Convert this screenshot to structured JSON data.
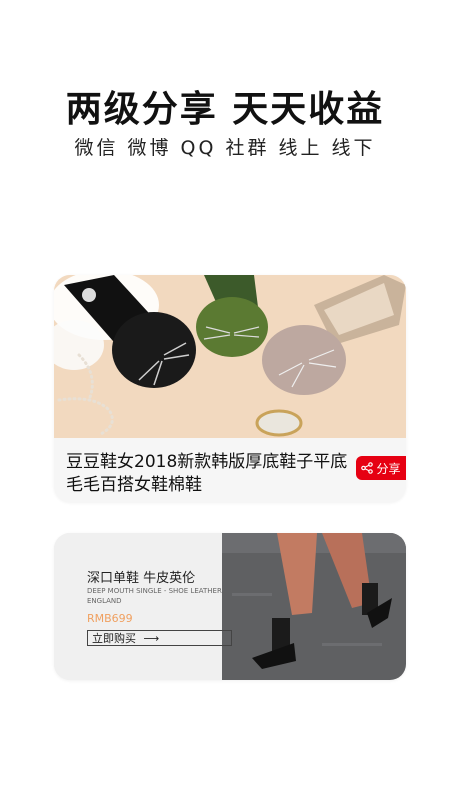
{
  "header": {
    "headline": "两级分享 天天收益",
    "subline": "微信 微博 QQ 社群 线上 线下"
  },
  "product_card": {
    "title": "豆豆鞋女2018新款韩版厚底鞋子平底毛毛百搭女鞋棉鞋",
    "share_label": "分享",
    "share_color": "#e60012"
  },
  "promo_card": {
    "title": "深口单鞋 牛皮英伦",
    "subtitle_en": "DEEP MOUTH SINGLE - SHOE LEATHER ENGLAND",
    "price": "RMB699",
    "buy_label": "立即购买",
    "buy_arrow": "⟶"
  }
}
